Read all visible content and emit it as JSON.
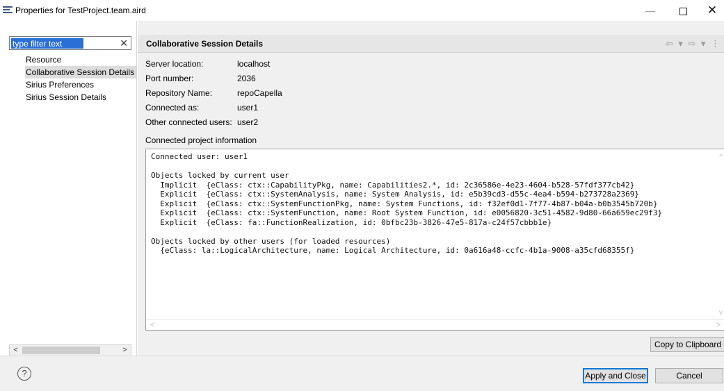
{
  "window": {
    "title": "Properties for TestProject.team.aird",
    "minimize": "—",
    "close": "✕"
  },
  "filter": {
    "value": "type filter text",
    "clear": "✕"
  },
  "nav": {
    "items": [
      {
        "label": "Resource"
      },
      {
        "label": "Collaborative Session Details"
      },
      {
        "label": "Sirius Preferences"
      },
      {
        "label": "Sirius Session Details"
      }
    ],
    "selected_index": 1
  },
  "section": {
    "title": "Collaborative Session Details",
    "back": "⇦ ▾",
    "forward": "⇨ ▾",
    "menu": "⋮"
  },
  "properties": {
    "server_location": {
      "label": "Server location:",
      "value": "localhost"
    },
    "port_number": {
      "label": "Port number:",
      "value": "2036"
    },
    "repository_name": {
      "label": "Repository Name:",
      "value": "repoCapella"
    },
    "connected_as": {
      "label": "Connected as:",
      "value": "user1"
    },
    "other_users": {
      "label": "Other connected users:",
      "value": "user2"
    }
  },
  "info": {
    "label": "Connected project information",
    "text": "Connected user: user1\n\nObjects locked by current user\n  Implicit  {eClass: ctx::CapabilityPkg, name: Capabilities2.*, id: 2c36586e-4e23-4604-b528-57fdf377cb42}\n  Explicit  {eClass: ctx::SystemAnalysis, name: System Analysis, id: e5b39cd3-d55c-4ea4-b594-b273728a2369}\n  Explicit  {eClass: ctx::SystemFunctionPkg, name: System Functions, id: f32ef0d1-7f77-4b87-b04a-b0b3545b720b}\n  Explicit  {eClass: ctx::SystemFunction, name: Root System Function, id: e0056820-3c51-4582-9d80-66a659ec29f3}\n  Explicit  {eClass: fa::FunctionRealization, id: 0bfbc23b-3826-47e5-817a-c24f57cbbb1e}\n\nObjects locked by other users (for loaded resources)\n  {eClass: la::LogicalArchitecture, name: Logical Architecture, id: 0a616a48-ccfc-4b1a-9008-a35cfd68355f}"
  },
  "buttons": {
    "copy": "Copy to Clipboard",
    "apply": "Apply and Close",
    "cancel": "Cancel",
    "help": "?"
  }
}
